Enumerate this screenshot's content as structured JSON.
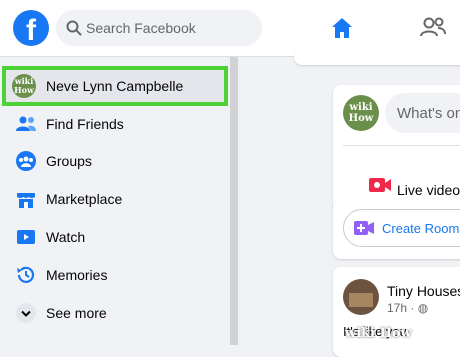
{
  "header": {
    "logo_letter": "f",
    "search_placeholder": "Search Facebook"
  },
  "sidebar": {
    "items": [
      {
        "label": "Neve Lynn Campbelle",
        "icon": "profile-avatar",
        "selected": true
      },
      {
        "label": "Find Friends",
        "icon": "friends-icon"
      },
      {
        "label": "Groups",
        "icon": "groups-icon"
      },
      {
        "label": "Marketplace",
        "icon": "marketplace-icon"
      },
      {
        "label": "Watch",
        "icon": "watch-icon"
      },
      {
        "label": "Memories",
        "icon": "memories-icon"
      },
      {
        "label": "See more",
        "icon": "chevron-down-icon"
      }
    ]
  },
  "composer": {
    "prompt": "What's on",
    "live_video": "Live video"
  },
  "rooms": {
    "create_room": "Create Room"
  },
  "post": {
    "author": "Tiny Houses",
    "time": "17h",
    "text": "It's like you"
  },
  "avatar_text": {
    "line1": "wiki",
    "line2": "How"
  },
  "watermark": "wiki How",
  "colors": {
    "brand": "#1877f2",
    "highlight": "#4cd137",
    "live": "#f02849",
    "room": "#9360f7"
  }
}
